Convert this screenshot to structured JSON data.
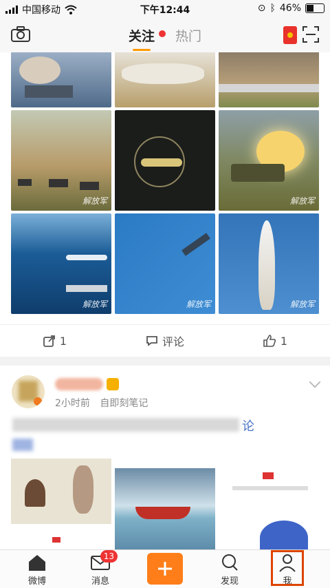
{
  "status_bar": {
    "carrier": "中国移动",
    "time": "下午12:44",
    "battery_percent": "46%",
    "battery_level": 0.46
  },
  "nav": {
    "tab_follow": "关注",
    "tab_hot": "热门",
    "left_icon": "camera-icon",
    "right_icons": [
      "red-envelope-icon",
      "scan-icon"
    ]
  },
  "post1": {
    "repost_count": "1",
    "comment_label": "评论",
    "like_count": "1",
    "watermark": "解放军"
  },
  "post2": {
    "time_ago": "2小时前",
    "source": "自即刻笔记",
    "link_text": "论"
  },
  "tabbar": {
    "items": [
      {
        "label": "微博",
        "icon": "home-icon"
      },
      {
        "label": "消息",
        "icon": "mail-icon",
        "badge": "13"
      },
      {
        "label": "",
        "icon": "plus-icon"
      },
      {
        "label": "发现",
        "icon": "search-icon"
      },
      {
        "label": "我",
        "icon": "profile-icon"
      }
    ]
  },
  "colors": {
    "accent": "#ff7e1a",
    "badge": "#e33333",
    "link": "#4a73c8"
  }
}
